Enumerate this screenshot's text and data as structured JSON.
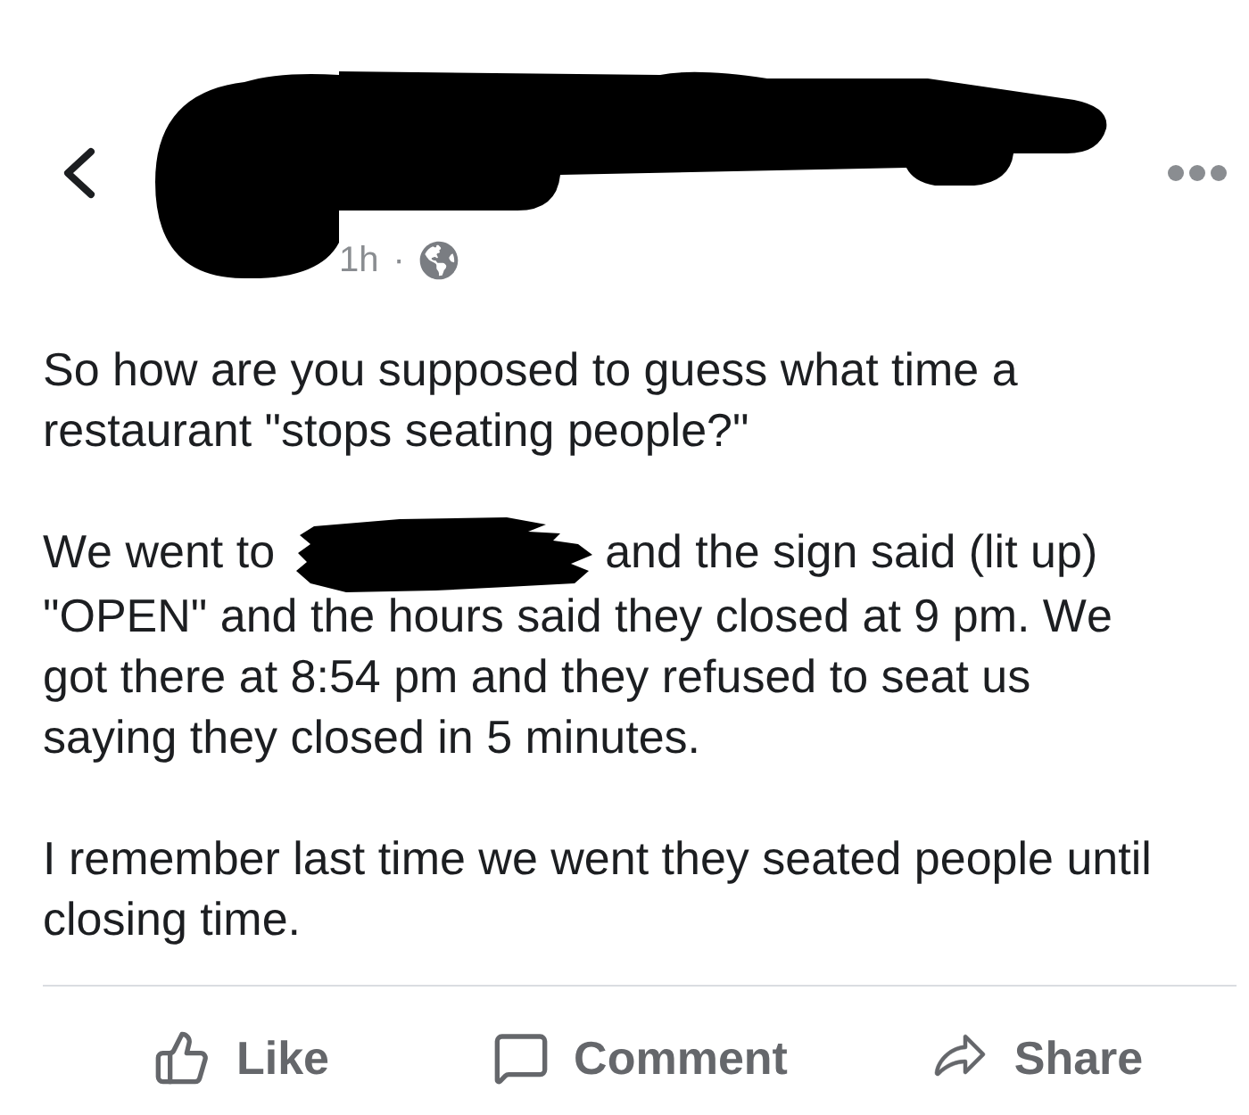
{
  "post": {
    "header": {
      "avatar": {
        "kind": "redaction"
      },
      "author": {
        "kind": "redaction"
      },
      "time": "1h",
      "separator": "·"
    },
    "paragraphs": [
      {
        "segments": [
          {
            "kind": "text",
            "text": "So how are you supposed to guess what time a restaurant \"stops seating people?\""
          }
        ]
      },
      {
        "segments": [
          {
            "kind": "text",
            "text": "We went to"
          },
          {
            "kind": "redaction"
          },
          {
            "kind": "text",
            "text": "and the sign said (lit up) \"OPEN\" and the hours said they closed at 9 pm. We got there at 8:54 pm and they refused to seat us saying they closed in 5 minutes."
          }
        ]
      },
      {
        "segments": [
          {
            "kind": "text",
            "text": "I remember last time we went they seated people until closing time."
          }
        ]
      }
    ],
    "actions": [
      {
        "kind": "like",
        "label": "Like"
      },
      {
        "kind": "comment",
        "label": "Comment"
      },
      {
        "kind": "share",
        "label": "Share"
      }
    ]
  }
}
